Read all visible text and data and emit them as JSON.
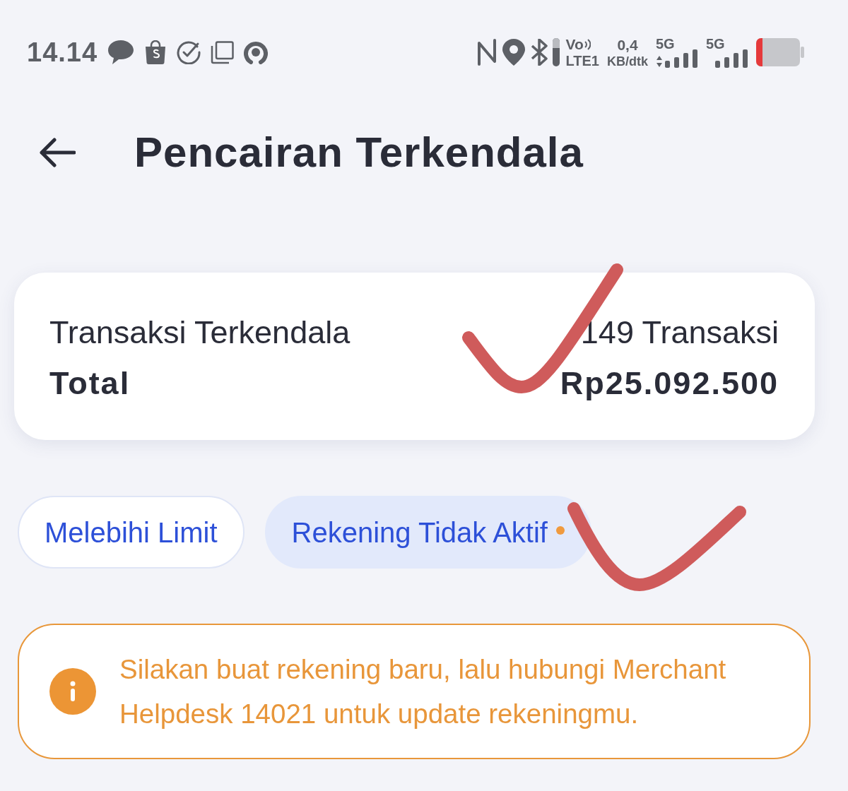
{
  "status_bar": {
    "time": "14.14",
    "volte": "Vo",
    "lte": "LTE1",
    "speed": "0,4",
    "speed_unit": "KB/dtk",
    "networks": [
      {
        "label": "5G",
        "arrows": true
      },
      {
        "label": "5G",
        "arrows": false
      }
    ]
  },
  "header": {
    "title": "Pencairan Terkendala"
  },
  "summary": {
    "rows": [
      {
        "kind": "count",
        "label": "Transaksi Terkendala",
        "value": "149 Transaksi"
      },
      {
        "kind": "total",
        "label": "Total",
        "value": "Rp25.092.500"
      }
    ]
  },
  "tabs": [
    {
      "label": "Melebihi Limit",
      "selected": false,
      "badge": false
    },
    {
      "label": "Rekening Tidak Aktif",
      "selected": true,
      "badge": true
    }
  ],
  "notice": {
    "text": "Silakan buat rekening baru, lalu hubungi Merchant Helpdesk 14021 untuk update rekeningmu."
  }
}
